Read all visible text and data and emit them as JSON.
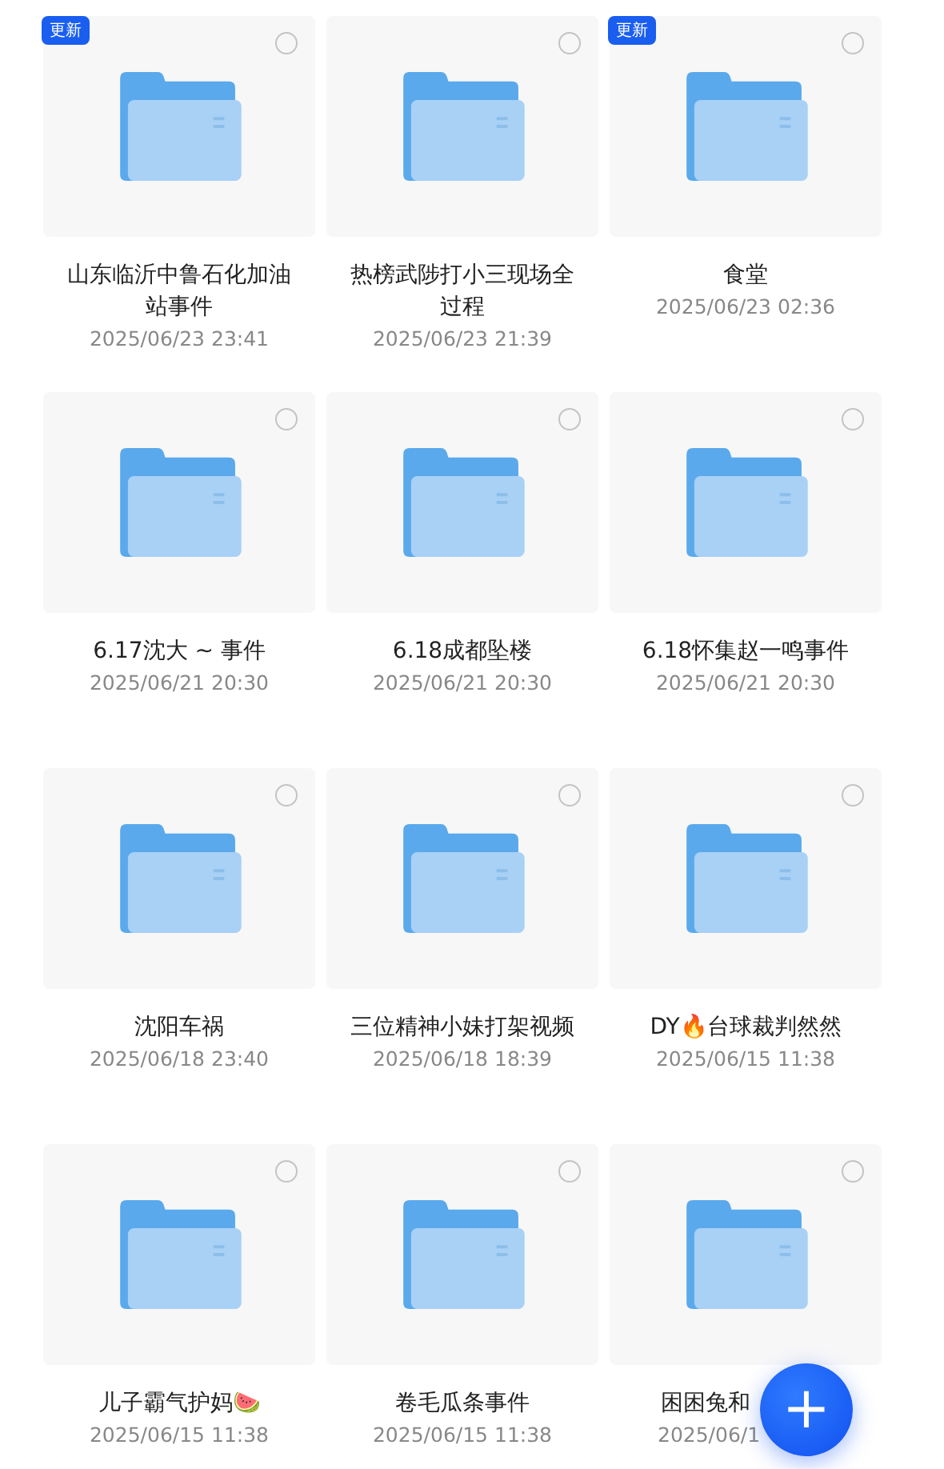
{
  "folders": [
    {
      "name": "山东临沂中鲁石化加油站事件",
      "date": "2025/06/23 23:41",
      "badge": "更新",
      "selected": false
    },
    {
      "name": "热榜武陟打小三现场全过程",
      "date": "2025/06/23 21:39",
      "selected": false
    },
    {
      "name": "食堂",
      "date": "2025/06/23 02:36",
      "badge": "更新",
      "selected": false
    },
    {
      "name": "6.17沈大 ~ 事件",
      "date": "2025/06/21 20:30",
      "selected": false
    },
    {
      "name": "6.18成都坠楼",
      "date": "2025/06/21 20:30",
      "selected": false
    },
    {
      "name": "6.18怀集赵一鸣事件",
      "date": "2025/06/21 20:30",
      "selected": false
    },
    {
      "name": "沈阳车祸",
      "date": "2025/06/18 23:40",
      "selected": false
    },
    {
      "name": "三位精神小妹打架视频",
      "date": "2025/06/18 18:39",
      "selected": false
    },
    {
      "name": "DY🔥台球裁判然然",
      "date": "2025/06/15 11:38",
      "selected": false
    },
    {
      "name": "儿子霸气护妈🍉",
      "date": "2025/06/15 11:38",
      "selected": false
    },
    {
      "name": "卷毛瓜条事件",
      "date": "2025/06/15 11:38",
      "selected": false
    },
    {
      "name": "困困兔和",
      "date": "2025/06/1",
      "selected": false
    }
  ],
  "fab": {
    "label": "+"
  }
}
